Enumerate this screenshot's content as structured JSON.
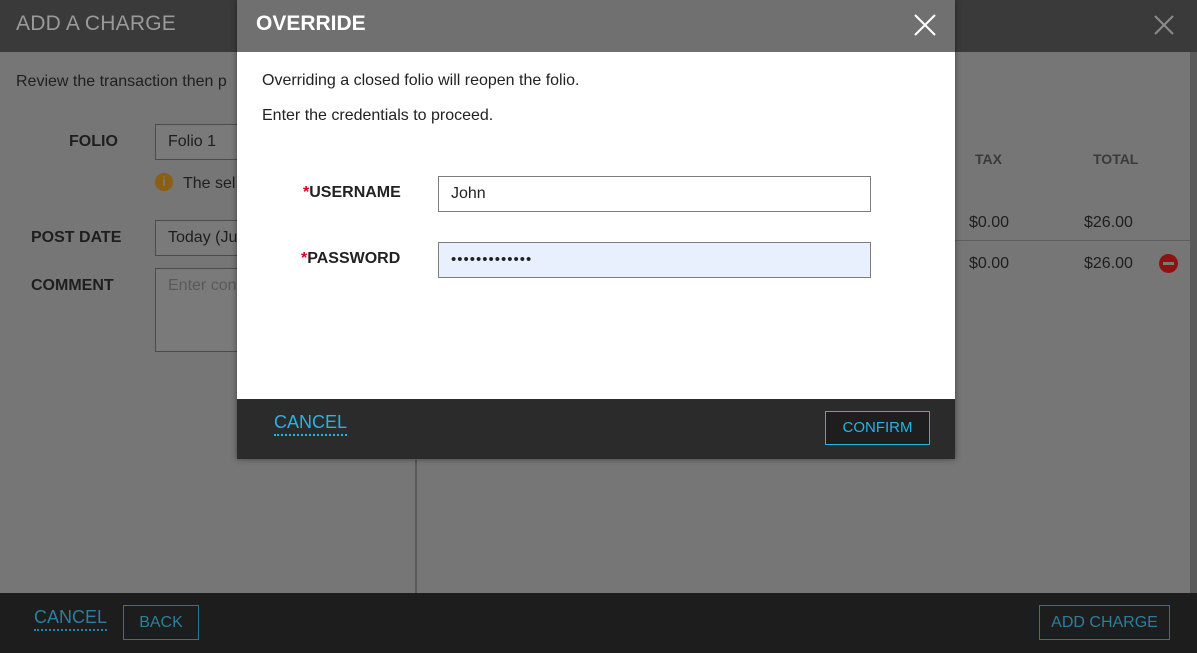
{
  "background": {
    "title": "ADD A CHARGE",
    "intro_text": "Review the transaction then p",
    "folio_label": "FOLIO",
    "folio_value": "Folio 1",
    "folio_note": "The sel",
    "post_date_label": "POST DATE",
    "post_date_value": "Today (Ju",
    "comment_label": "COMMENT",
    "comment_placeholder": "Enter con",
    "table": {
      "headers": [
        "TAX",
        "TOTAL"
      ],
      "rows": [
        {
          "tax": "$0.00",
          "total": "$26.00"
        },
        {
          "tax": "$0.00",
          "total": "$26.00"
        }
      ]
    },
    "footer": {
      "cancel_label": "CANCEL",
      "back_label": "BACK",
      "add_charge_label": "ADD CHARGE"
    },
    "icons": {
      "close": "close-icon",
      "info": "info-icon",
      "remove": "remove-icon"
    }
  },
  "modal": {
    "title": "OVERRIDE",
    "message_line1": "Overriding a closed folio will reopen the folio.",
    "message_line2": "Enter the credentials to proceed.",
    "required_marker": "*",
    "username_label": "USERNAME",
    "username_value": "John",
    "password_label": "PASSWORD",
    "password_value": "•••••••••••••",
    "cancel_label": "CANCEL",
    "confirm_label": "CONFIRM"
  },
  "colors": {
    "accent": "#28b3e3",
    "required": "#d0021b",
    "modal_header": "#707070",
    "footer": "#2b2b2b"
  }
}
